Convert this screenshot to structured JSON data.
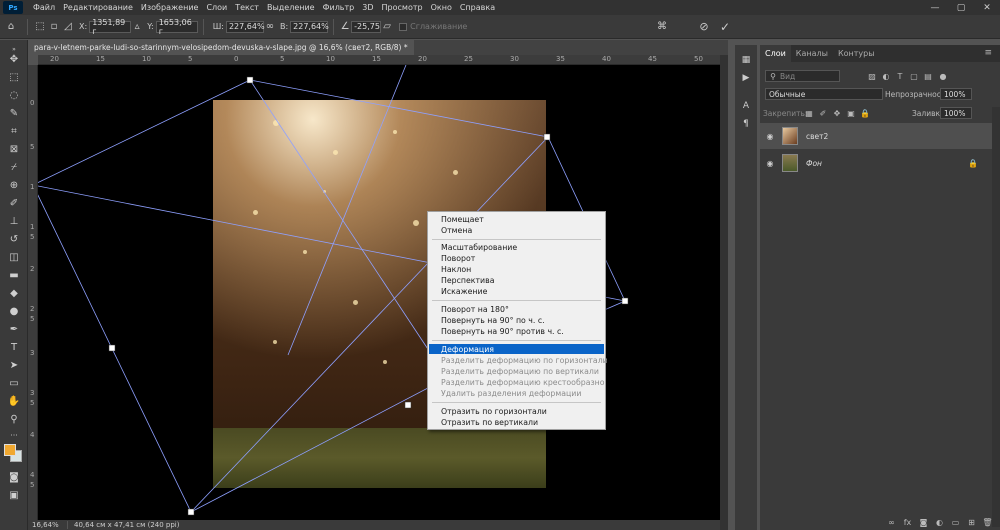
{
  "app": {
    "logo": "Ps"
  },
  "menubar": {
    "items": [
      "Файл",
      "Редактирование",
      "Изображение",
      "Слои",
      "Текст",
      "Выделение",
      "Фильтр",
      "3D",
      "Просмотр",
      "Окно",
      "Справка"
    ]
  },
  "window_controls": {
    "minimize": "—",
    "maximize": "▢",
    "close": "✕"
  },
  "options_bar": {
    "x_label": "X:",
    "x_value": "1351,89 г",
    "y_label": "Y:",
    "y_value": "1653,06 г",
    "w_label": "Ш:",
    "w_value": "227,64%",
    "h_label": "В:",
    "h_value": "227,64%",
    "angle_value": "-25,75",
    "smoothing_label": "Сглаживание",
    "cancel_icon": "cancel-icon",
    "commit_icon": "check-icon"
  },
  "document": {
    "tab_title": "para-v-letnem-parke-ludi-so-starinnym-velosipedom-devuska-v-slape.jpg @ 16,6% (свет2, RGB/8) *"
  },
  "rulers": {
    "top_ticks": [
      "20",
      "15",
      "10",
      "5",
      "0",
      "5",
      "10",
      "15",
      "20",
      "25",
      "30",
      "35",
      "40",
      "45",
      "50"
    ],
    "left_ticks": [
      "0",
      "5",
      "1",
      "1",
      "5",
      "2",
      "2",
      "5",
      "3",
      "3",
      "5",
      "4",
      "4",
      "5"
    ]
  },
  "status_bar": {
    "zoom": "16,64%",
    "doc_size": "40,64 см x 47,41 см (240 ppi)"
  },
  "panels": {
    "tabs": [
      "Слои",
      "Каналы",
      "Контуры"
    ],
    "search_placeholder": "Вид",
    "blend_mode": "Обычные",
    "opacity_label": "Непрозрачность:",
    "opacity_value": "100%",
    "lock_label": "Закрепить:",
    "fill_label": "Заливка:",
    "fill_value": "100%",
    "layers": [
      {
        "name": "свет2",
        "selected": true
      },
      {
        "name": "Фон",
        "selected": false
      }
    ]
  },
  "context_menu": {
    "items": [
      {
        "label": "Помещает",
        "disabled": false
      },
      {
        "label": "Отмена",
        "disabled": false
      },
      {
        "label": "Масштабирование",
        "disabled": false
      },
      {
        "label": "Поворот",
        "disabled": false
      },
      {
        "label": "Наклон",
        "disabled": false
      },
      {
        "label": "Перспектива",
        "disabled": false
      },
      {
        "label": "Искажение",
        "disabled": false
      },
      {
        "label": "Поворот на 180°",
        "disabled": false
      },
      {
        "label": "Повернуть на 90° по ч. с.",
        "disabled": false
      },
      {
        "label": "Повернуть на 90° против ч. с.",
        "disabled": false
      },
      {
        "label": "Деформация",
        "disabled": false,
        "highlight": true
      },
      {
        "label": "Разделить деформацию по горизонтали",
        "disabled": true
      },
      {
        "label": "Разделить деформацию по вертикали",
        "disabled": true
      },
      {
        "label": "Разделить деформацию крестообразно",
        "disabled": true
      },
      {
        "label": "Удалить разделения деформации",
        "disabled": true
      },
      {
        "label": "Отразить по горизонтали",
        "disabled": false
      },
      {
        "label": "Отразить по вертикали",
        "disabled": false
      }
    ]
  },
  "colors": {
    "foreground": "#f0a830",
    "background": "#d8e3e3",
    "menu_highlight": "#0a64c8"
  }
}
